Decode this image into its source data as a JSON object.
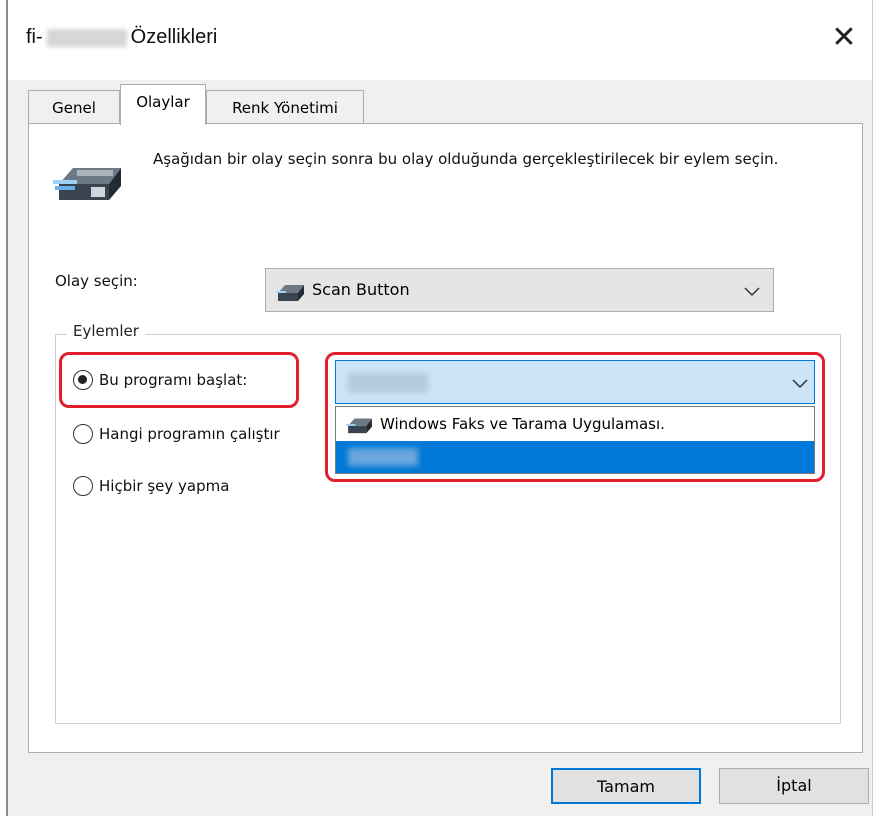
{
  "window": {
    "title_prefix": "fi-",
    "title_suffix": "Özellikleri"
  },
  "close_glyph": "✕",
  "tabs": [
    {
      "label": "Genel",
      "active": false
    },
    {
      "label": "Olaylar",
      "active": true
    },
    {
      "label": "Renk Yönetimi",
      "active": false
    }
  ],
  "description": "Aşağıdan bir olay seçin sonra bu olay olduğunda gerçekleştirilecek bir eylem seçin.",
  "event_select": {
    "label": "Olay seçin:",
    "value": "Scan Button"
  },
  "actions": {
    "title": "Eylemler",
    "options": [
      {
        "label": "Bu programı başlat:",
        "checked": true
      },
      {
        "label": "Hangi programın çalıştır",
        "checked": false
      },
      {
        "label": "Hiçbir şey yapma",
        "checked": false
      }
    ]
  },
  "program_dropdown": {
    "items": [
      {
        "label": "Windows Faks ve Tarama Uygulaması."
      }
    ]
  },
  "buttons": {
    "ok": "Tamam",
    "cancel": "İptal"
  },
  "colors": {
    "highlight": "#e0202e",
    "selection": "#0078d7",
    "field_focus": "#cce4f7"
  },
  "icons": [
    "scanner-icon",
    "scanner-small-icon",
    "chevron-down-icon",
    "close-icon"
  ]
}
